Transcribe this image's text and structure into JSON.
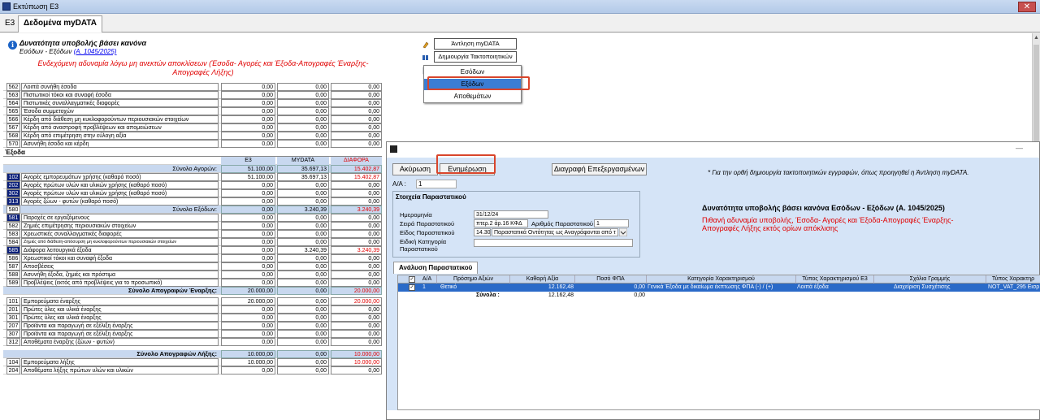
{
  "window": {
    "title": "Εκτύπωση Ε3",
    "close": "✕"
  },
  "tabs": {
    "e3": "Ε3",
    "mydata": "Δεδομένα myDATA"
  },
  "info": {
    "title": "Δυνατότητα υποβολής βάσει κανόνα",
    "subtitle": "Εσόδων - Εξόδων",
    "link": "(Α. 1045/2025)",
    "warning": "Ενδεχόμενη αδυναμία λόγω μη ανεκτών αποκλίσεων (Έσοδα- Αγορές και Έξοδα-Απογραφές Έναρξης-Απογραφές Λήξης)"
  },
  "actions": {
    "fetch": "Άντληση myDATA",
    "create": "Δημιουργία Τακτοποιητικών"
  },
  "menu": {
    "items": [
      "Εσόδων",
      "Εξόδων",
      "Αποθεμάτων"
    ],
    "selected": "Εξόδων"
  },
  "table": {
    "rows_top": [
      {
        "code": "562",
        "label": "Λοιπά συνήθη έσοδα",
        "v1": "0,00",
        "v2": "0,00",
        "v3": "0,00"
      },
      {
        "code": "563",
        "label": "Πιστωτικοί τόκοι και συναφή έσοδα",
        "v1": "0,00",
        "v2": "0,00",
        "v3": "0,00"
      },
      {
        "code": "564",
        "label": "Πιστωτικές συναλλαγματικές διαφορές",
        "v1": "0,00",
        "v2": "0,00",
        "v3": "0,00"
      },
      {
        "code": "565",
        "label": "Έσοδα συμμετοχών",
        "v1": "0,00",
        "v2": "0,00",
        "v3": "0,00"
      },
      {
        "code": "566",
        "label": "Κέρδη από διάθεση μη κυκλοφορούντων περιουσιακών στοιχείων",
        "v1": "0,00",
        "v2": "0,00",
        "v3": "0,00"
      },
      {
        "code": "567",
        "label": "Κέρδη από αναστροφή προβλέψεων και απομειώσεων",
        "v1": "0,00",
        "v2": "0,00",
        "v3": "0,00"
      },
      {
        "code": "568",
        "label": "Κέρδη από επιμέτρηση στην εύλογη αξία",
        "v1": "0,00",
        "v2": "0,00",
        "v3": "0,00"
      },
      {
        "code": "570",
        "label": "Ασυνήθη έσοδα και κέρδη",
        "v1": "0,00",
        "v2": "0,00",
        "v3": "0,00"
      }
    ],
    "section_expenses": "Έξοδα",
    "headers": [
      "Ε3",
      "MYDATA",
      "ΔΙΑΦΟΡΑ"
    ],
    "total_purchases": {
      "label": "Σύνολο Αγορών:",
      "v1": "51.100,00",
      "v2": "35.697,13",
      "v3": "15.402,87"
    },
    "rows_purchases": [
      {
        "code": "102",
        "label": "Αγορές εμπορευμάτων χρήσης (καθαρό ποσό)",
        "v1": "51.100,00",
        "v2": "35.697,13",
        "v3": "15.402,87",
        "hl": true,
        "red": true
      },
      {
        "code": "202",
        "label": "Αγορές πρώτων υλών και υλικών χρήσης (καθαρό ποσό)",
        "v1": "0,00",
        "v2": "0,00",
        "v3": "0,00",
        "hl": true
      },
      {
        "code": "302",
        "label": "Αγορές πρώτων υλών και υλικών χρήσης (καθαρό ποσό)",
        "v1": "0,00",
        "v2": "0,00",
        "v3": "0,00",
        "hl": true
      },
      {
        "code": "313",
        "label": "Αγορές ζώων - φυτών (καθαρό ποσό)",
        "v1": "0,00",
        "v2": "0,00",
        "v3": "0,00",
        "hl": true
      }
    ],
    "total_expenses": {
      "code": "580",
      "label": "Σύνολο Εξόδων:",
      "v1": "0,00",
      "v2": "3.240,39",
      "v3": "3.240,39"
    },
    "rows_expenses": [
      {
        "code": "581",
        "label": "Παροχές σε εργαζόμενους",
        "v1": "0,00",
        "v2": "0,00",
        "v3": "0,00",
        "hl": true
      },
      {
        "code": "582",
        "label": "Ζημιές επιμέτρησης περιουσιακών στοιχείων",
        "v1": "0,00",
        "v2": "0,00",
        "v3": "0,00"
      },
      {
        "code": "583",
        "label": "Χρεωστικές συναλλαγματικές διαφορές",
        "v1": "0,00",
        "v2": "0,00",
        "v3": "0,00"
      },
      {
        "code": "584",
        "label": "Ζημιές από διάθεση-απόσυρση μη κυκλοφορούντων περιουσιακών στοιχείων",
        "v1": "0,00",
        "v2": "0,00",
        "v3": "0,00",
        "small": true
      },
      {
        "code": "585",
        "label": "Διάφορα λειτουργικά έξοδα",
        "v1": "0,00",
        "v2": "3.240,39",
        "v3": "3.240,39",
        "hl": true,
        "red": true
      },
      {
        "code": "586",
        "label": "Χρεωστικοί τόκοι και συναφή έξοδα",
        "v1": "0,00",
        "v2": "0,00",
        "v3": "0,00"
      },
      {
        "code": "587",
        "label": "Αποσβέσεις",
        "v1": "0,00",
        "v2": "0,00",
        "v3": "0,00"
      },
      {
        "code": "588",
        "label": "Ασυνήθη έξοδα, ζημιές και πρόστιμα",
        "v1": "0,00",
        "v2": "0,00",
        "v3": "0,00"
      },
      {
        "code": "589",
        "label": "Προβλέψεις (εκτός από προβλέψεις για το προσωπικό)",
        "v1": "0,00",
        "v2": "0,00",
        "v3": "0,00"
      }
    ],
    "total_opening": {
      "label": "Σύνολο Απογραφών Έναρξης:",
      "v1": "20.000,00",
      "v2": "0,00",
      "v3": "20.000,00"
    },
    "rows_opening": [
      {
        "code": "101",
        "label": "Εμπορεύματα έναρξης",
        "v1": "20.000,00",
        "v2": "0,00",
        "v3": "20.000,00",
        "red": true
      },
      {
        "code": "201",
        "label": "Πρώτες ύλες και υλικά έναρξης",
        "v1": "0,00",
        "v2": "0,00",
        "v3": "0,00"
      },
      {
        "code": "301",
        "label": "Πρώτες ύλες και υλικά έναρξης",
        "v1": "0,00",
        "v2": "0,00",
        "v3": "0,00"
      },
      {
        "code": "207",
        "label": "Προϊόντα και παραγωγή σε εξέλιξη έναρξης",
        "v1": "0,00",
        "v2": "0,00",
        "v3": "0,00"
      },
      {
        "code": "307",
        "label": "Προϊόντα και παραγωγή σε εξέλιξη έναρξης",
        "v1": "0,00",
        "v2": "0,00",
        "v3": "0,00"
      },
      {
        "code": "312",
        "label": "Αποθέματα έναρξης (ζώων - φυτών)",
        "v1": "0,00",
        "v2": "0,00",
        "v3": "0,00"
      }
    ],
    "total_closing": {
      "label": "Σύνολο Απογραφών Λήξης:",
      "v1": "10.000,00",
      "v2": "0,00",
      "v3": "10.000,00"
    },
    "rows_closing": [
      {
        "code": "104",
        "label": "Εμπορεύματα λήξης",
        "v1": "10.000,00",
        "v2": "0,00",
        "v3": "10.000,00",
        "red": true
      },
      {
        "code": "204",
        "label": "Αποθέματα λήξης πρώτων υλών και υλικών",
        "v1": "0,00",
        "v2": "0,00",
        "v3": "0,00"
      }
    ]
  },
  "form": {
    "minimize": "—",
    "cancel": "Ακύρωση",
    "update": "Ενημέρωση",
    "delete_processed": "Διαγραφή Επεξεργασμένων",
    "note": "* Για την ορθή δημιουργία τακτοποιητικών εγγραφών, όπως προηγηθεί η Άντληση myDATA.",
    "aa_label": "Α/Α :",
    "aa_value": "1",
    "doc_title": "Στοιχεία Παραστατικού",
    "date_label": "Ημερομηνία",
    "date_value": "31/12/24",
    "series_label": "Σειρά Παραστατικού",
    "series_value": "πτερ.2 άρ.16 ΚΦΔ",
    "number_label": "Αριθμός Παραστατικού",
    "number_value": "1",
    "type_label": "Είδος Παραστατικού",
    "type_code": "14.30",
    "type_value": "Παραστατικά Οντότητας ως Αναγράφονται από τ",
    "special_label": "Ειδική Κατηγορία Παραστατικού",
    "rule_title": "Δυνατότητα υποβολής βάσει κανόνα Εσόδων - Εξόδων (Α. 1045/2025)",
    "rule_warning": "Πιθανή αδυναμία υποβολής, Έσοδα- Αγορές και Έξοδα-Απογραφές Έναρξης-Απογραφές Λήξης εκτός ορίων απόκλισης",
    "analysis_tab": "Ανάλυση Παραστατικού",
    "grid_headers": [
      "Α/Α",
      "Πρόσημο Αξιών",
      "Καθαρή Αξία",
      "Ποσό ΦΠΑ",
      "Κατηγορία Χαρακτηρισμού",
      "Τύπος Χαρακτηρισμού Ε3",
      "Σχόλια Γραμμής",
      "Τύπος Χαρακτηρ"
    ],
    "grid_row": {
      "aa": "1",
      "sign": "Θετικό",
      "net": "12.162,48",
      "vat": "0,00",
      "category": "Γενικά Έξοδα με δικαίωμα έκπτωσης ΦΠΑ (-) / (+)",
      "e3_type": "Λοιπά έξοδα",
      "comments": "Διαχείριση Συσχέτισης",
      "type2": "NOT_VAT_295 Εισρ"
    },
    "totals_label": "Σύνολα :",
    "totals_net": "12.162,48",
    "totals_vat": "0,00"
  }
}
